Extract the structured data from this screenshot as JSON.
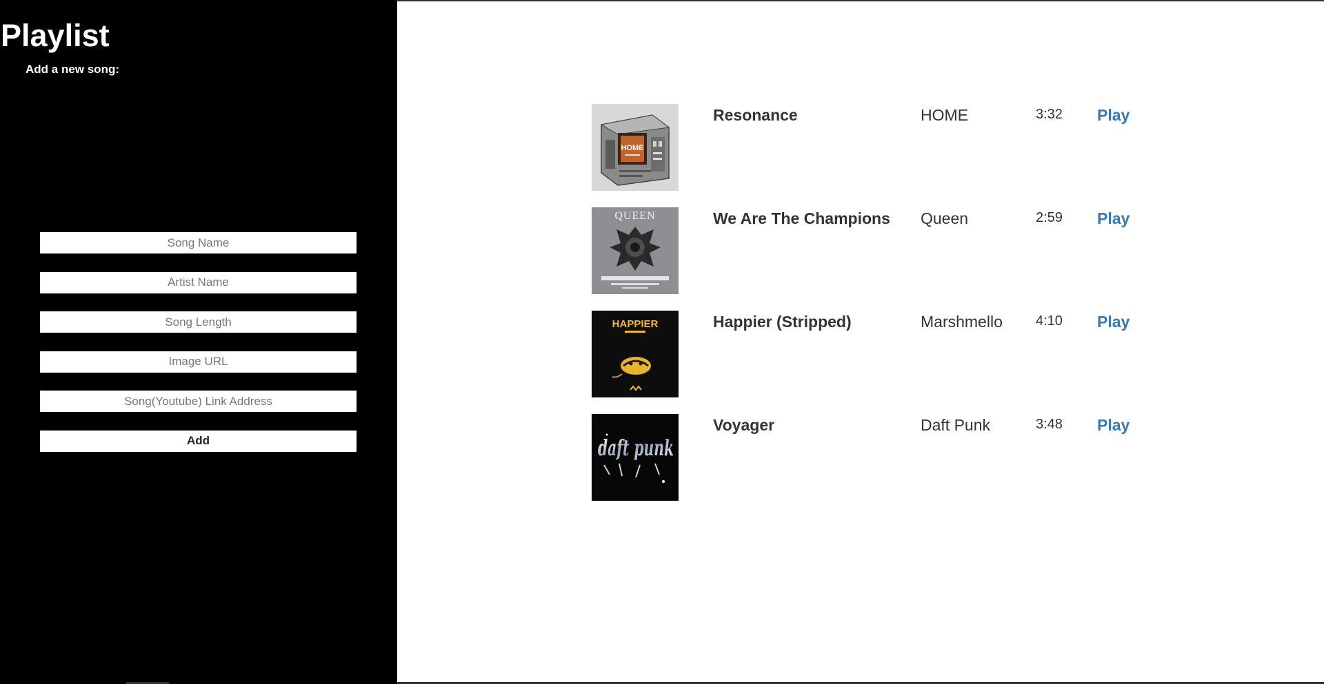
{
  "sidebar": {
    "title": "Playlist",
    "subtitle": "Add a new song:",
    "form": {
      "song_name_placeholder": "Song Name",
      "artist_name_placeholder": "Artist Name",
      "song_length_placeholder": "Song Length",
      "image_url_placeholder": "Image URL",
      "link_placeholder": "Song(Youtube) Link Address",
      "add_label": "Add"
    }
  },
  "songs": [
    {
      "title": "Resonance",
      "artist": "HOME",
      "length": "3:32",
      "play_label": "Play",
      "cover": "home-odyssey-cover",
      "cover_text": "HOME"
    },
    {
      "title": "We Are The Champions",
      "artist": "Queen",
      "length": "2:59",
      "play_label": "Play",
      "cover": "queen-greatest-hits-cover",
      "cover_text": "QUEEN"
    },
    {
      "title": "Happier (Stripped)",
      "artist": "Marshmello",
      "length": "4:10",
      "play_label": "Play",
      "cover": "happier-stripped-cover",
      "cover_text": "HAPPIER"
    },
    {
      "title": "Voyager",
      "artist": "Daft Punk",
      "length": "3:48",
      "play_label": "Play",
      "cover": "daft-punk-discovery-cover",
      "cover_text": "daft punk"
    }
  ],
  "colors": {
    "sidebar_bg": "#000000",
    "content_bg": "#ffffff",
    "link": "#337ab7",
    "text": "#333333"
  }
}
